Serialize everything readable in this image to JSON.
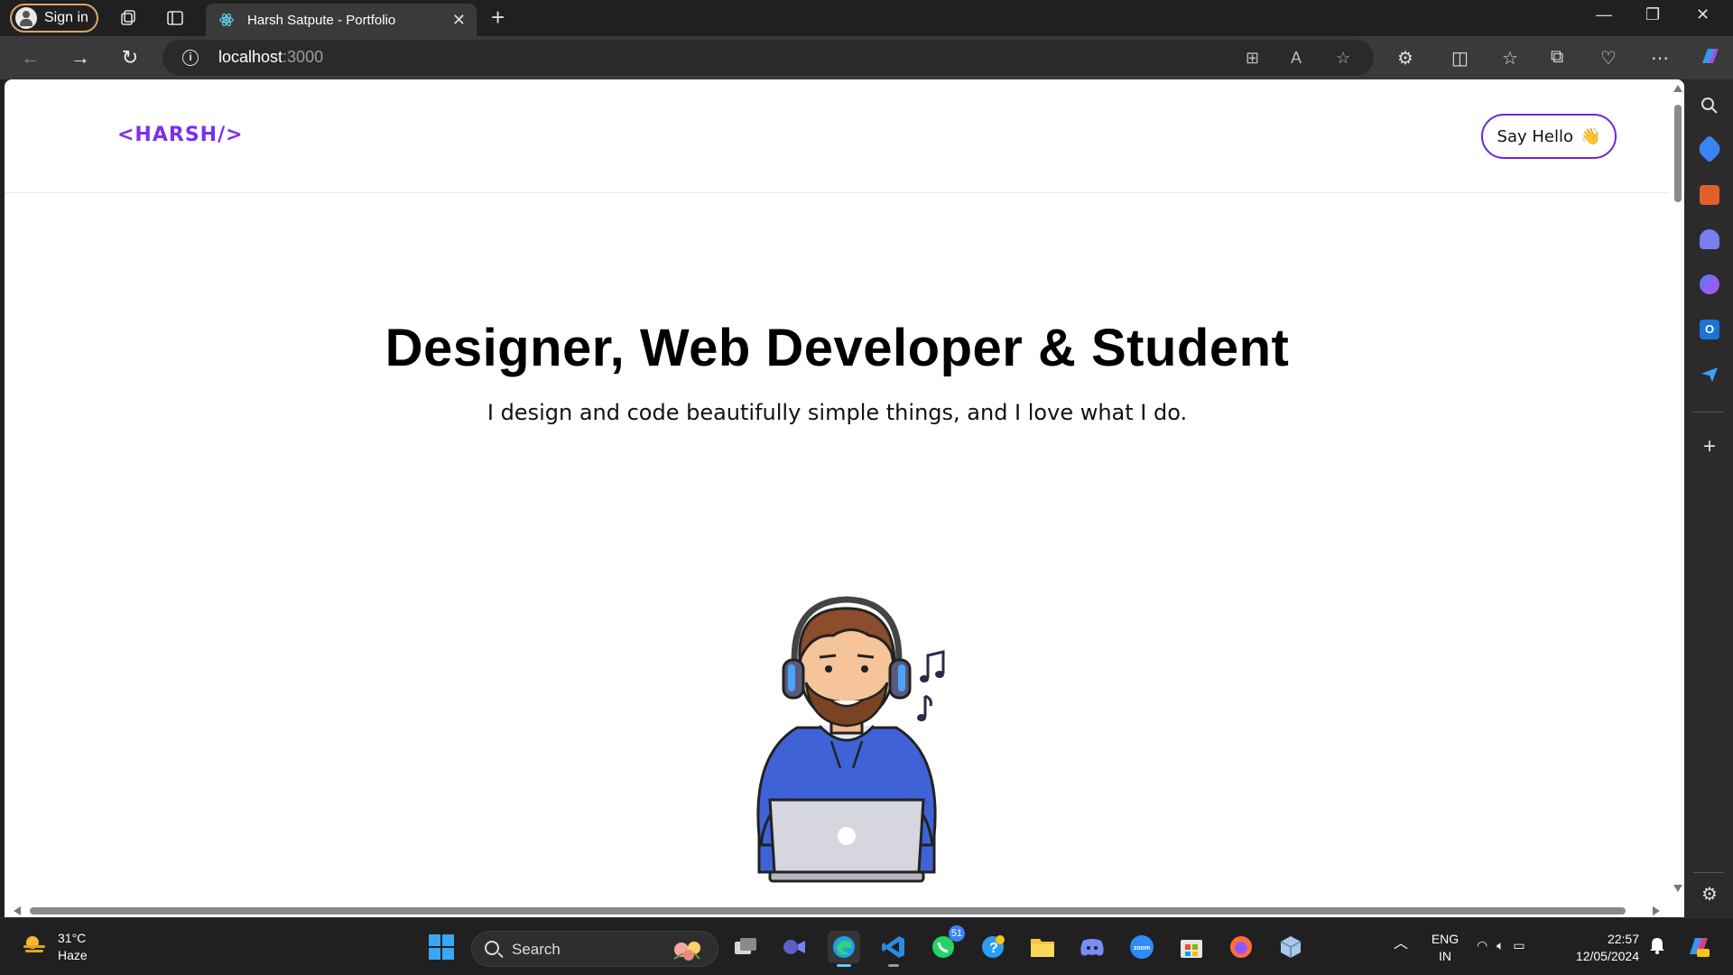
{
  "browser": {
    "sign_in": "Sign in",
    "tab_title": "Harsh Satpute - Portfolio",
    "url_host": "localhost",
    "url_port": ":3000"
  },
  "site": {
    "logo": "<HARSH/>",
    "say_hello": "Say Hello",
    "say_hello_emoji": "👋",
    "hero_title": "Designer, Web Developer & Student",
    "hero_subtitle": "I design and code beautifully simple things, and I love what I do.",
    "accent_color": "#6d28d9"
  },
  "taskbar": {
    "temperature": "31°C",
    "condition": "Haze",
    "search_label": "Search",
    "whatsapp_badge": "51",
    "lang_line1": "ENG",
    "lang_line2": "IN",
    "time": "22:57",
    "date": "12/05/2024"
  },
  "icons": [
    "workspaces-icon",
    "tab-actions-icon",
    "react-favicon",
    "back-icon",
    "forward-icon",
    "refresh-icon",
    "info-icon",
    "apps-icon",
    "read-aloud-icon",
    "favorite-icon",
    "extensions-icon",
    "split-screen-icon",
    "favorites-icon",
    "collections-icon",
    "health-icon",
    "more-icon",
    "copilot-icon"
  ]
}
